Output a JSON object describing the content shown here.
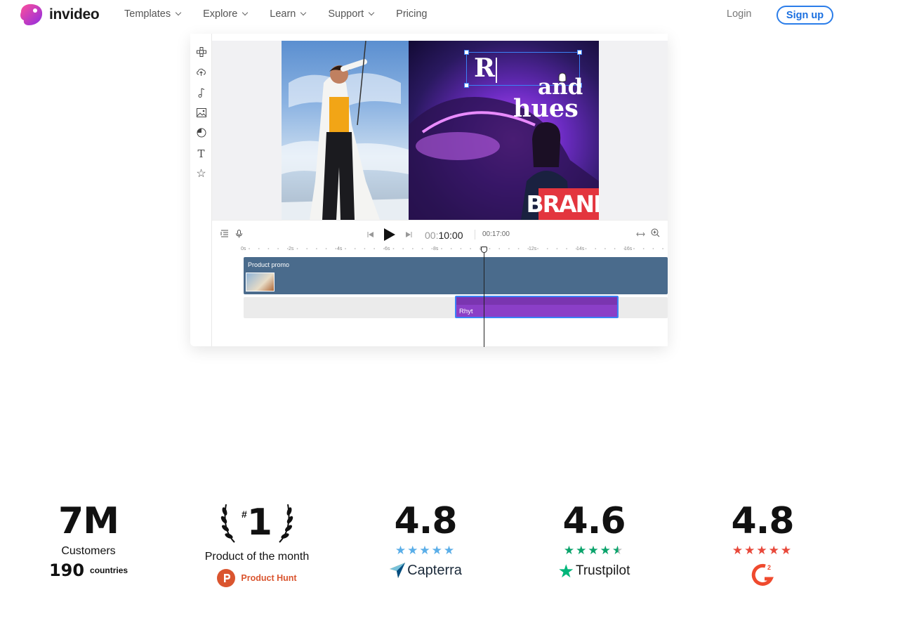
{
  "nav": {
    "brand": "invideo",
    "links": [
      {
        "label": "Templates",
        "has_menu": true
      },
      {
        "label": "Explore",
        "has_menu": true
      },
      {
        "label": "Learn",
        "has_menu": true
      },
      {
        "label": "Support",
        "has_menu": true
      },
      {
        "label": "Pricing",
        "has_menu": false
      }
    ],
    "login": "Login",
    "signup": "Sign up"
  },
  "editor": {
    "typed_text": "R",
    "headline_line2": "and",
    "headline_line3": "hues",
    "badge_text": "BRAND",
    "time_current_prefix": "00:",
    "time_current": "10:00",
    "time_total": "00:17:00",
    "ruler_labels": [
      "0s",
      "2s",
      "4s",
      "6s",
      "8s",
      "10s",
      "12s",
      "14s",
      "16s"
    ],
    "track_main_label": "Product promo",
    "clip_label": "Rhyt"
  },
  "stats": {
    "customers": {
      "value": "7M",
      "label": "Customers",
      "countries_value": "190",
      "countries_label": "countries"
    },
    "product_hunt": {
      "rank_prefix": "#",
      "rank": "1",
      "label": "Product of the month",
      "source": "Product Hunt"
    },
    "capterra": {
      "rating": "4.8",
      "stars": 5,
      "source": "Capterra",
      "star_color": "#5aaee8"
    },
    "trustpilot": {
      "rating": "4.6",
      "stars": 4.5,
      "source": "Trustpilot",
      "star_color": "#0aa36b"
    },
    "g2": {
      "rating": "4.8",
      "stars": 5,
      "source": "G2",
      "star_color": "#e8483a"
    }
  },
  "colors": {
    "accent": "#2b7de9",
    "clip": "#8b3fc7",
    "track": "#4a6b8c"
  }
}
